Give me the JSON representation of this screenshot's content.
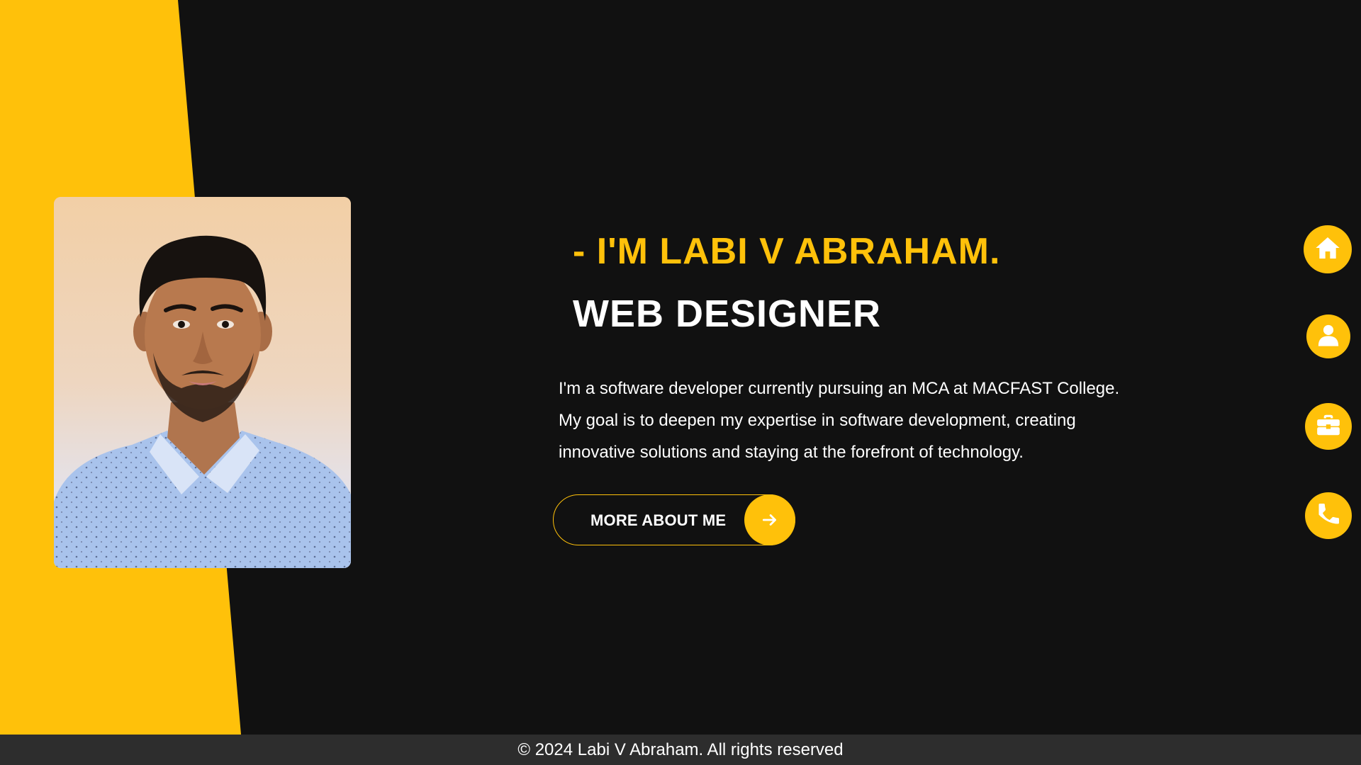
{
  "hero": {
    "name_line": "- I'M LABI V ABRAHAM.",
    "role_line": "WEB DESIGNER",
    "description": "I'm a software developer currently pursuing an MCA at MACFAST College. My goal is to deepen my expertise in software development, creating innovative solutions and staying at the forefront of technology.",
    "cta_label": "MORE ABOUT ME",
    "cta_icon": "arrow-right-icon"
  },
  "side_nav": {
    "items": [
      {
        "icon": "home-icon"
      },
      {
        "icon": "user-icon"
      },
      {
        "icon": "briefcase-icon"
      },
      {
        "icon": "phone-icon"
      }
    ]
  },
  "footer": {
    "text": "© 2024 Labi V Abraham. All rights reserved"
  },
  "colors": {
    "accent": "#ffc10a",
    "background": "#111111",
    "footer_bg": "#2d2d2d",
    "text": "#ffffff"
  }
}
